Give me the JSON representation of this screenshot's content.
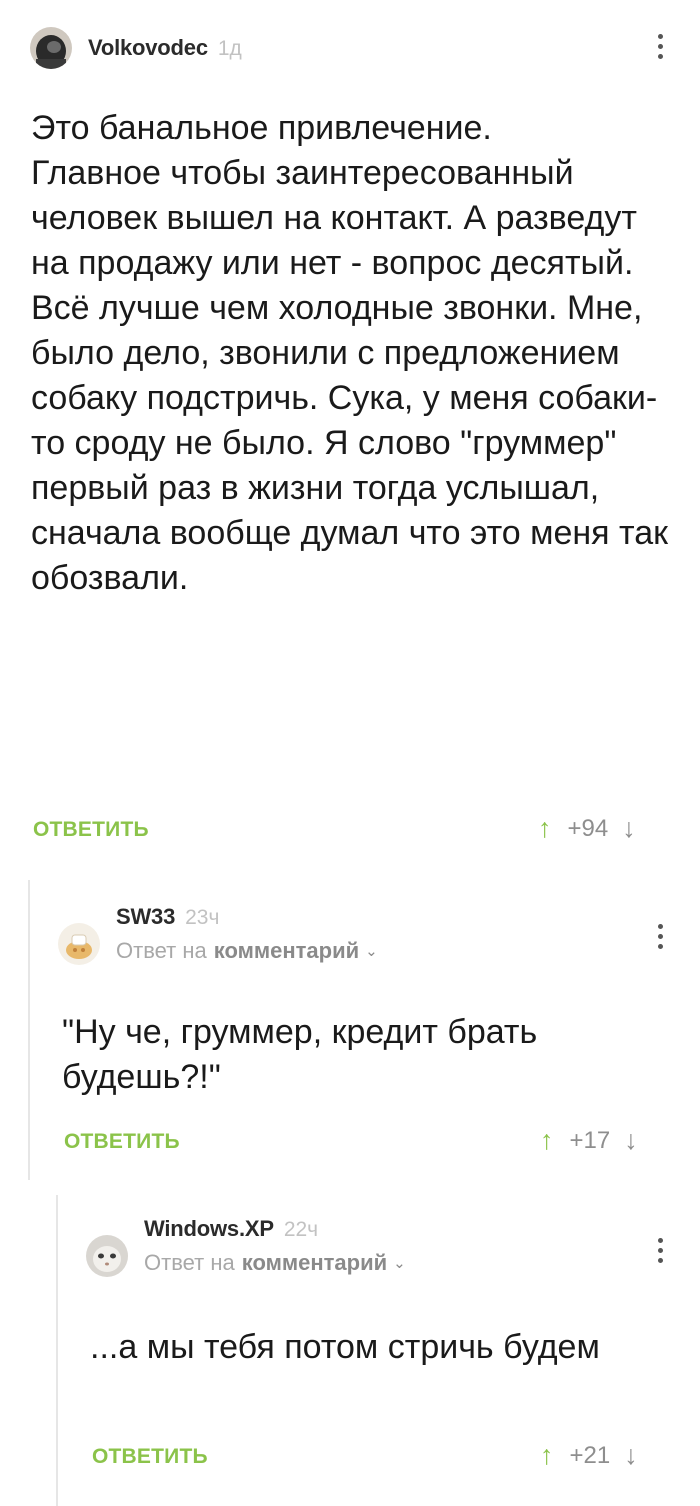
{
  "comments": [
    {
      "author": "Volkovodec",
      "time": "1д",
      "text": "Это банальное привлечение.\nГлавное чтобы заинтересованный человек вышел на контакт. А разведут на продажу или нет - вопрос десятый.\nВсё лучше чем холодные звонки. Мне, было дело, звонили с предложением собаку подстричь. Сука, у меня собаки-то сроду не было. Я слово \"груммер\" первый раз в жизни тогда услышал, сначала вообще думал что это меня так обозвали.",
      "reply_label": "ОТВЕТИТЬ",
      "score": "+94"
    },
    {
      "author": "SW33",
      "time": "23ч",
      "reply_prefix": "Ответ на",
      "reply_target": "комментарий",
      "text": "\"Ну че, груммер, кредит брать будешь?!\"",
      "reply_label": "ОТВЕТИТЬ",
      "score": "+17"
    },
    {
      "author": "Windows.XP",
      "time": "22ч",
      "reply_prefix": "Ответ на",
      "reply_target": "комментарий",
      "text": "...а мы тебя потом стричь будем",
      "reply_label": "ОТВЕТИТЬ",
      "score": "+21"
    }
  ],
  "icons": {
    "upvote": "↑",
    "downvote": "↓",
    "chevron": "⌄"
  },
  "colors": {
    "accent_green": "#8bc34a",
    "muted_gray": "#8e8e8e"
  }
}
